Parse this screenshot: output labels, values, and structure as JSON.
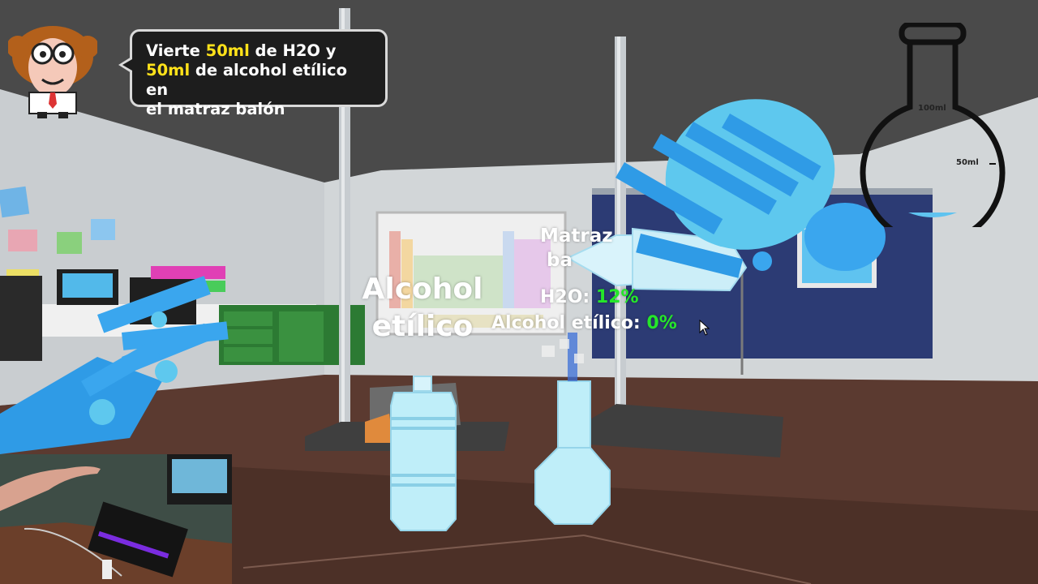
{
  "instruction": {
    "part1": "Vierte ",
    "amount1": "50ml",
    "part2": " de H2O y",
    "amount2": "50ml",
    "part3": "  de alcohol etílico en",
    "part4": "el matraz balón"
  },
  "labels": {
    "alcohol_line1": "Alcohol",
    "alcohol_line2": "etílico",
    "matraz_line1": "Matraz",
    "matraz_line2": "ba"
  },
  "readout": {
    "h2o_label": "H2O:",
    "h2o_value": "12%",
    "alcohol_label": "Alcohol etílico:",
    "alcohol_value": "0%"
  },
  "gauge": {
    "mark_100": "100ml",
    "mark_50": "50ml"
  },
  "colors": {
    "highlight": "#ffe21a",
    "percent": "#25e62a",
    "hand": "#2f9be6",
    "glass": "#bfeef9",
    "liquid": "#5fc3f0"
  },
  "icons": [
    "professor-avatar-icon",
    "cursor-arrow-icon",
    "flask-gauge-icon"
  ]
}
